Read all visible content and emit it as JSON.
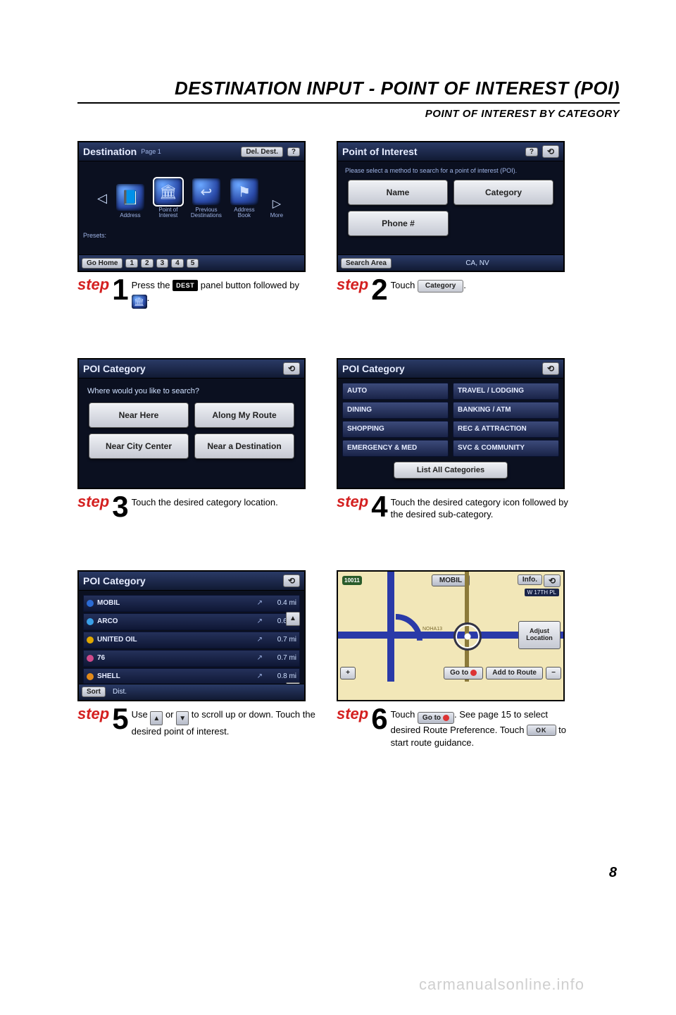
{
  "title": "DESTINATION INPUT - POINT OF INTEREST (POI)",
  "subtitle": "POINT OF INTEREST BY CATEGORY",
  "page_number": "8",
  "watermark": "carmanualsonline.info",
  "step_word": "step",
  "step1": {
    "screen": {
      "header": "Destination",
      "header_page": "Page 1",
      "del_dest": "Del. Dest.",
      "help": "?",
      "icons": {
        "address": {
          "label": "Address",
          "glyph": "📘"
        },
        "poi": {
          "label": "Point of Interest",
          "glyph": "🏛"
        },
        "previous": {
          "label": "Previous Destinations",
          "glyph": "↩"
        },
        "addr_book": {
          "label": "Address Book",
          "glyph": "⚑"
        },
        "more": {
          "label": "More"
        }
      },
      "presets_label": "Presets:",
      "footer": {
        "go_home": "Go Home",
        "p1": "1",
        "p2": "2",
        "p3": "3",
        "p4": "4",
        "p5": "5"
      }
    },
    "caption": {
      "num": "1",
      "t1": "Press the ",
      "dest_btn": "DEST",
      "t2": " panel button followed by ",
      "t3": "."
    }
  },
  "step2": {
    "screen": {
      "header": "Point of Interest",
      "help": "?",
      "prompt": "Please select a method to search for a point of interest (POI).",
      "name": "Name",
      "category": "Category",
      "phone": "Phone #",
      "footer_label": "Search Area",
      "footer_value": "CA, NV"
    },
    "caption": {
      "num": "2",
      "t1": "Touch ",
      "btn": "Category",
      "t2": "."
    }
  },
  "step3": {
    "screen": {
      "header": "POI Category",
      "prompt": "Where would you like to search?",
      "near_here": "Near Here",
      "along_route": "Along My Route",
      "near_city": "Near City Center",
      "near_dest": "Near a Destination"
    },
    "caption": {
      "num": "3",
      "text": "Touch the desired category location."
    }
  },
  "step4": {
    "screen": {
      "header": "POI Category",
      "left": [
        "AUTO",
        "DINING",
        "SHOPPING",
        "EMERGENCY & MED"
      ],
      "right": [
        "TRAVEL / LODGING",
        "BANKING / ATM",
        "REC & ATTRACTION",
        "SVC & COMMUNITY"
      ],
      "list_all": "List All Categories"
    },
    "caption": {
      "num": "4",
      "text": "Touch the desired category icon followed by the desired sub-category."
    }
  },
  "step5": {
    "screen": {
      "header": "POI Category",
      "rows": [
        {
          "color": "#2b6bd4",
          "name": "MOBIL",
          "dist": "0.4 mi"
        },
        {
          "color": "#3aa0e8",
          "name": "ARCO",
          "dist": "0.6 mi"
        },
        {
          "color": "#e0a800",
          "name": "UNITED OIL",
          "dist": "0.7 mi"
        },
        {
          "color": "#d04a8a",
          "name": "76",
          "dist": "0.7 mi"
        },
        {
          "color": "#e28a1a",
          "name": "SHELL",
          "dist": "0.8 mi"
        }
      ],
      "footer": {
        "sort": "Sort",
        "dist": "Dist."
      }
    },
    "caption": {
      "num": "5",
      "t1": "Use ",
      "t2": " or ",
      "t3": " to scroll up or down.  Touch the desired point of interest."
    }
  },
  "step6": {
    "screen": {
      "banner": "MOBIL",
      "info": "Info.",
      "street": "W 17TH PL",
      "shield": "10011",
      "noha": "NOHA13",
      "adjust": "Adjust Location",
      "footer": {
        "plus": "+",
        "goto": "Go to",
        "add": "Add to Route",
        "minus": "−"
      }
    },
    "caption": {
      "num": "6",
      "t1": "Touch ",
      "goto": "Go to",
      "t2": ". See page 15 to select desired Route Preference. Touch ",
      "ok": "OK",
      "t3": " to start route guidance."
    }
  }
}
